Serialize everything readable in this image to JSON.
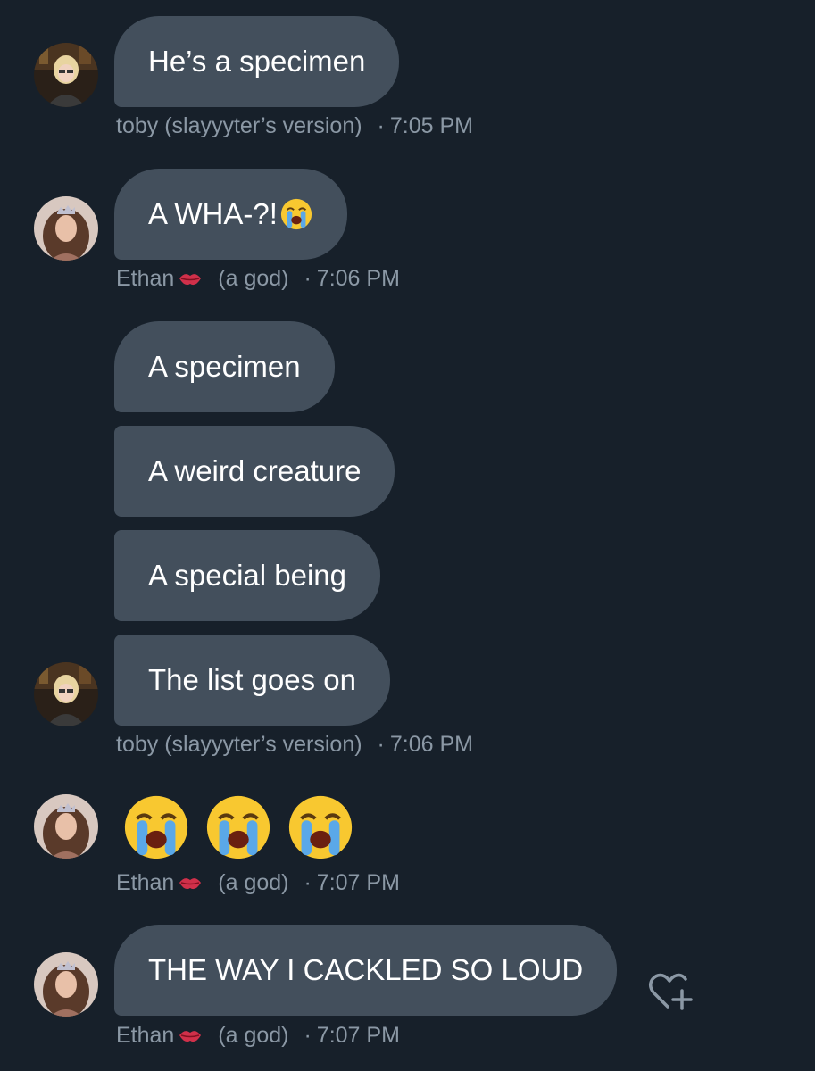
{
  "messages": [
    {
      "text": "He’s a specimen"
    },
    {
      "text": "A WHA-?!"
    },
    {
      "text": "A specimen"
    },
    {
      "text": "A weird creature"
    },
    {
      "text": "A special being"
    },
    {
      "text": "The list goes on"
    },
    {
      "text": ""
    },
    {
      "text": "THE WAY I CACKLED SO LOUD"
    }
  ],
  "meta": [
    {
      "name": "toby (slayyyter’s version)",
      "time": "7:05 PM"
    },
    {
      "name": "Ethan",
      "suffix": "(a god)",
      "time": "7:06 PM"
    },
    {
      "name": "toby (slayyyter’s version)",
      "time": "7:06 PM"
    },
    {
      "name": "Ethan",
      "suffix": "(a god)",
      "time": "7:07 PM"
    },
    {
      "name": "Ethan",
      "suffix": "(a god)",
      "time": "7:07 PM"
    }
  ],
  "separator": "·",
  "icons": {
    "emoji_crying": "loudly-crying-face",
    "emoji_kiss": "kiss-mark",
    "react": "heart-plus-icon"
  },
  "colors": {
    "background": "#17202a",
    "bubble": "#434f5c",
    "meta_text": "#8b98a5",
    "icon": "#8b98a5"
  }
}
